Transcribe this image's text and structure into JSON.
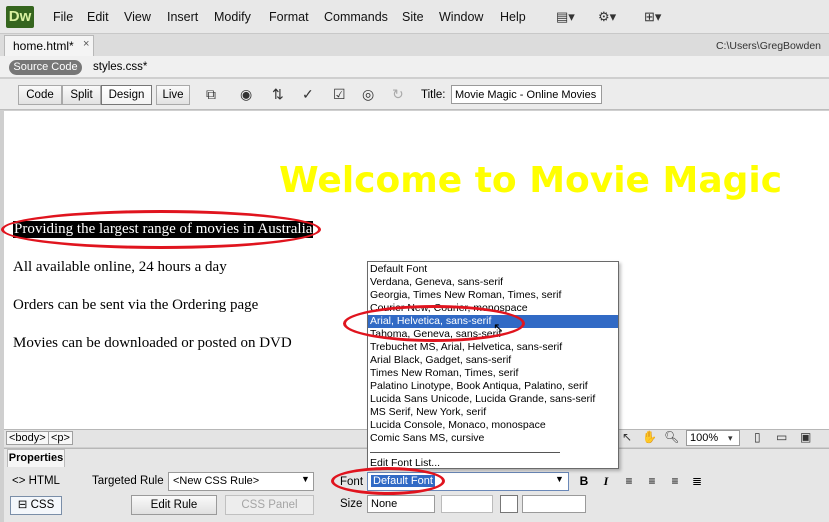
{
  "app": {
    "logo": "Dw"
  },
  "menu": [
    "File",
    "Edit",
    "View",
    "Insert",
    "Modify",
    "Format",
    "Commands",
    "Site",
    "Window",
    "Help"
  ],
  "menubar_icons": [
    "layout-icon",
    "gear-icon",
    "site-icon"
  ],
  "document_tab": {
    "label": "home.html*",
    "close": "×"
  },
  "file_path": "C:\\Users\\GregBowden",
  "related_files": {
    "source_code": "Source Code",
    "css_file": "styles.css*"
  },
  "view_buttons": {
    "code": "Code",
    "split": "Split",
    "design": "Design",
    "live": "Live"
  },
  "title_field": {
    "label": "Title:",
    "value": "Movie Magic - Online Movies"
  },
  "page_content": {
    "heading": "Welcome to Movie Magic",
    "lines": [
      "Providing the largest range of movies in Australia",
      "All available online, 24 hours a day",
      "Orders can be sent via the Ordering page",
      "Movies can be downloaded or posted on DVD"
    ],
    "heading_color": "#ffff00"
  },
  "tag_selector": [
    "<body>",
    "<p>"
  ],
  "zoom": "100%",
  "properties": {
    "tab": "Properties",
    "html_label": "HTML",
    "css_label": "CSS",
    "targeted_rule_label": "Targeted Rule",
    "targeted_rule_value": "<New CSS Rule>",
    "edit_rule": "Edit Rule",
    "css_panel": "CSS Panel",
    "font_label": "Font",
    "font_value": "Default Font",
    "size_label": "Size",
    "size_value": "None",
    "format_buttons": [
      "B",
      "I"
    ]
  },
  "font_list": [
    "Default Font",
    "Verdana, Geneva, sans-serif",
    "Georgia, Times New Roman, Times, serif",
    "Courier New, Courier, monospace",
    "Arial, Helvetica, sans-serif",
    "Tahoma, Geneva, sans-serif",
    "Trebuchet MS, Arial, Helvetica, sans-serif",
    "Arial Black, Gadget, sans-serif",
    "Times New Roman, Times, serif",
    "Palatino Linotype, Book Antiqua, Palatino, serif",
    "Lucida Sans Unicode, Lucida Grande, sans-serif",
    "MS Serif, New York, serif",
    "Lucida Console, Monaco, monospace",
    "Comic Sans MS, cursive",
    "Edit Font List..."
  ],
  "font_list_selected": "Arial, Helvetica, sans-serif",
  "accent_colors": {
    "selection": "#316ac5",
    "callout": "#e0141e",
    "logo_bg": "#35651e"
  }
}
